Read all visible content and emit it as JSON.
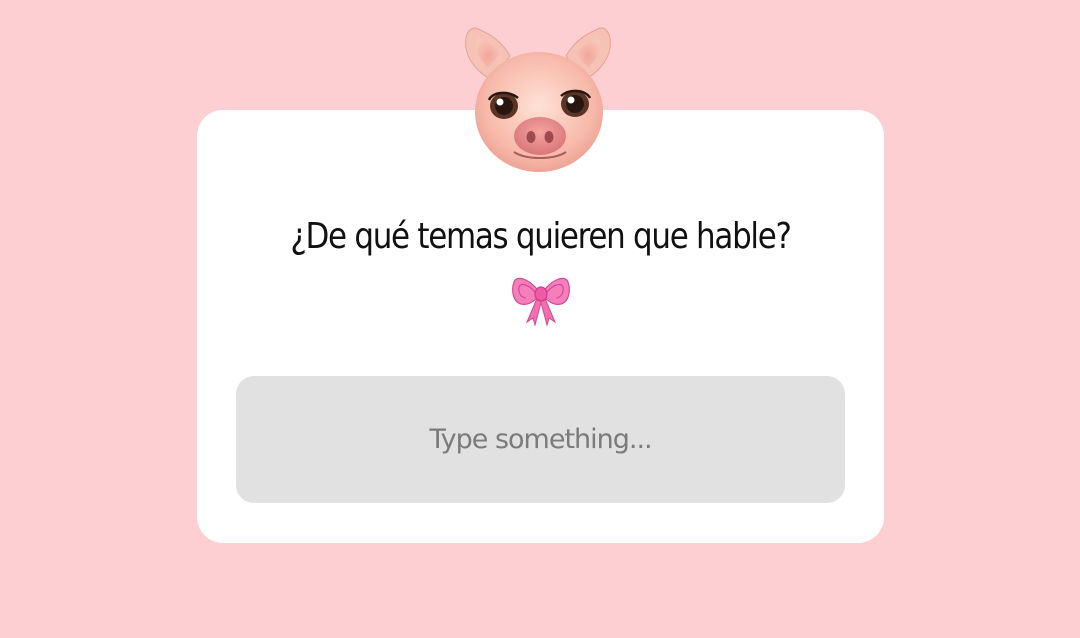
{
  "question": {
    "text": "¿De qué temas quieren que hable?",
    "icon": "ribbon-bow-icon"
  },
  "avatar": {
    "icon": "pig-face-icon"
  },
  "answer_input": {
    "placeholder": "Type something...",
    "value": ""
  },
  "colors": {
    "background": "#fecfd2",
    "card": "#ffffff",
    "input_fill": "#e1e1e1",
    "placeholder": "#7b7b7b",
    "bow": "#f36db1"
  }
}
